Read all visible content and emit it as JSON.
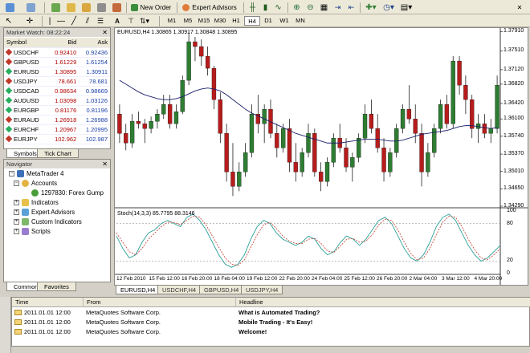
{
  "toolbar": {
    "new_order": "New Order",
    "expert_advisors": "Expert Advisors",
    "timeframes": [
      "M1",
      "M5",
      "M15",
      "M30",
      "H1",
      "H4",
      "D1",
      "W1",
      "MN"
    ],
    "active_timeframe": "H4",
    "text_tool": "A",
    "icons": [
      "new-chart-icon",
      "profiles-icon",
      "zoom-in-icon",
      "zoom-out-icon",
      "tile-icon",
      "crosshair-icon",
      "cursor-icon",
      "line-icon",
      "period-icon",
      "template-icon"
    ]
  },
  "market_watch": {
    "title": "Market Watch: 08:22:24",
    "col_symbol": "Symbol",
    "col_bid": "Bid",
    "col_ask": "Ask",
    "rows": [
      {
        "symbol": "USDCHF",
        "bid": "0.92410",
        "ask": "0.92436"
      },
      {
        "symbol": "GBPUSD",
        "bid": "1.61229",
        "ask": "1.61254"
      },
      {
        "symbol": "EURUSD",
        "bid": "1.30895",
        "ask": "1.30911"
      },
      {
        "symbol": "USDJPY",
        "bid": "78.661",
        "ask": "78.681"
      },
      {
        "symbol": "USDCAD",
        "bid": "0.98634",
        "ask": "0.98669"
      },
      {
        "symbol": "AUDUSD",
        "bid": "1.03098",
        "ask": "1.03126"
      },
      {
        "symbol": "EURGBP",
        "bid": "0.81176",
        "ask": "0.81196"
      },
      {
        "symbol": "EURAUD",
        "bid": "1.26918",
        "ask": "1.26988"
      },
      {
        "symbol": "EURCHF",
        "bid": "1.20967",
        "ask": "1.20995"
      },
      {
        "symbol": "EURJPY",
        "bid": "102.962",
        "ask": "102.987"
      }
    ],
    "tabs": [
      "Symbols",
      "Tick Chart"
    ]
  },
  "navigator": {
    "title": "Navigator",
    "root": "MetaTrader 4",
    "accounts": "Accounts",
    "account": "1297830: Forex Gump",
    "indicators": "Indicators",
    "expert_advisors": "Expert Advisors",
    "custom_indicators": "Custom Indicators",
    "scripts": "Scripts",
    "tabs": [
      "Common",
      "Favorites"
    ]
  },
  "chart": {
    "header": "EURUSD,H4  1.30865 1.30917 1.30848 1.30895",
    "stoch_header": "Stoch(14,3,3) 85.7795 88.3146",
    "price_labels": [
      "1.37910",
      "1.37510",
      "1.37120",
      "1.36820",
      "1.36420",
      "1.36100",
      "1.35740",
      "1.35370",
      "1.35010",
      "1.34650",
      "1.34290"
    ],
    "stoch_labels": [
      "100",
      "80",
      "20",
      "0"
    ],
    "time_labels": [
      "12 Feb 2010",
      "15 Feb 12:00",
      "16 Feb 20:00",
      "18 Feb 04:00",
      "19 Feb 12:00",
      "22 Feb 20:00",
      "24 Feb 04:00",
      "25 Feb 12:00",
      "26 Feb 20:00",
      "2 Mar 04:00",
      "3 Mar 12:00",
      "4 Mar 20:00"
    ],
    "tabs": [
      "EURUSD,H4",
      "USDCHF,H4",
      "GBPUSD,H4",
      "USDJPY,H4"
    ],
    "active_tab": "EURUSD,H4",
    "up_color": "#2e7d32",
    "down_color": "#b71c1c",
    "ma_color": "#1b1f6b",
    "stoch_main_color": "#2aa198",
    "stoch_signal_color": "#c0392b"
  },
  "chart_data": {
    "type": "candlestick",
    "symbol": "EURUSD",
    "timeframe": "H4",
    "ylim": [
      1.3429,
      1.3795
    ],
    "candles": [
      [
        1.362,
        1.364,
        1.356,
        1.358
      ],
      [
        1.358,
        1.36,
        1.3545,
        1.356
      ],
      [
        1.356,
        1.362,
        1.355,
        1.3605
      ],
      [
        1.3605,
        1.3625,
        1.359,
        1.36
      ],
      [
        1.36,
        1.361,
        1.356,
        1.359
      ],
      [
        1.359,
        1.3615,
        1.358,
        1.3605
      ],
      [
        1.3605,
        1.363,
        1.359,
        1.362
      ],
      [
        1.362,
        1.366,
        1.361,
        1.364
      ],
      [
        1.364,
        1.366,
        1.359,
        1.36
      ],
      [
        1.36,
        1.364,
        1.359,
        1.3625
      ],
      [
        1.3625,
        1.37,
        1.362,
        1.369
      ],
      [
        1.369,
        1.379,
        1.368,
        1.377
      ],
      [
        1.377,
        1.378,
        1.373,
        1.376
      ],
      [
        1.376,
        1.3775,
        1.372,
        1.374
      ],
      [
        1.374,
        1.376,
        1.37,
        1.3715
      ],
      [
        1.3715,
        1.372,
        1.363,
        1.365
      ],
      [
        1.365,
        1.3665,
        1.356,
        1.358
      ],
      [
        1.358,
        1.36,
        1.348,
        1.35
      ],
      [
        1.35,
        1.356,
        1.345,
        1.347
      ],
      [
        1.347,
        1.352,
        1.346,
        1.35
      ],
      [
        1.35,
        1.356,
        1.349,
        1.354
      ],
      [
        1.354,
        1.364,
        1.353,
        1.362
      ],
      [
        1.362,
        1.366,
        1.358,
        1.36
      ],
      [
        1.36,
        1.364,
        1.356,
        1.363
      ],
      [
        1.363,
        1.365,
        1.357,
        1.358
      ],
      [
        1.358,
        1.36,
        1.353,
        1.355
      ],
      [
        1.355,
        1.36,
        1.354,
        1.359
      ],
      [
        1.359,
        1.361,
        1.35,
        1.352
      ],
      [
        1.352,
        1.356,
        1.348,
        1.35
      ],
      [
        1.35,
        1.355,
        1.349,
        1.354
      ],
      [
        1.354,
        1.36,
        1.353,
        1.358
      ],
      [
        1.358,
        1.359,
        1.349,
        1.35
      ],
      [
        1.35,
        1.352,
        1.346,
        1.348
      ],
      [
        1.348,
        1.353,
        1.347,
        1.352
      ],
      [
        1.352,
        1.358,
        1.351,
        1.357
      ],
      [
        1.357,
        1.36,
        1.354,
        1.355
      ],
      [
        1.355,
        1.357,
        1.35,
        1.351
      ],
      [
        1.351,
        1.354,
        1.348,
        1.353
      ],
      [
        1.353,
        1.358,
        1.352,
        1.357
      ],
      [
        1.357,
        1.364,
        1.356,
        1.362
      ],
      [
        1.362,
        1.365,
        1.358,
        1.359
      ],
      [
        1.359,
        1.362,
        1.354,
        1.355
      ],
      [
        1.355,
        1.357,
        1.348,
        1.35
      ],
      [
        1.35,
        1.355,
        1.349,
        1.354
      ],
      [
        1.354,
        1.36,
        1.353,
        1.359
      ],
      [
        1.359,
        1.364,
        1.358,
        1.363
      ],
      [
        1.363,
        1.368,
        1.36,
        1.361
      ],
      [
        1.361,
        1.364,
        1.356,
        1.358
      ],
      [
        1.358,
        1.36,
        1.347,
        1.35
      ],
      [
        1.35,
        1.356,
        1.349,
        1.354
      ],
      [
        1.354,
        1.36,
        1.353,
        1.359
      ],
      [
        1.359,
        1.365,
        1.358,
        1.364
      ],
      [
        1.364,
        1.366,
        1.359,
        1.36
      ],
      [
        1.36,
        1.374,
        1.359,
        1.373
      ],
      [
        1.373,
        1.374,
        1.366,
        1.368
      ],
      [
        1.368,
        1.37,
        1.362,
        1.365
      ],
      [
        1.365,
        1.366,
        1.357,
        1.359
      ],
      [
        1.359,
        1.362,
        1.356,
        1.36
      ],
      [
        1.36,
        1.362,
        1.357,
        1.358
      ],
      [
        1.358,
        1.361,
        1.356,
        1.359
      ],
      [
        1.359,
        1.37,
        1.358,
        1.368
      ]
    ],
    "moving_average": [
      1.369,
      1.3682,
      1.3674,
      1.3666,
      1.366,
      1.3656,
      1.3652,
      1.365,
      1.365,
      1.3652,
      1.3656,
      1.3662,
      1.3668,
      1.3672,
      1.3674,
      1.3672,
      1.3668,
      1.366,
      1.365,
      1.364,
      1.363,
      1.3622,
      1.3616,
      1.361,
      1.3604,
      1.3598,
      1.3592,
      1.3586,
      1.358,
      1.3576,
      1.3572,
      1.3568,
      1.3564,
      1.356,
      1.356,
      1.356,
      1.3562,
      1.3564,
      1.3566,
      1.3568,
      1.3568,
      1.3568,
      1.3566,
      1.3564,
      1.3564,
      1.3566,
      1.357,
      1.3574,
      1.3578,
      1.358,
      1.3582,
      1.3584,
      1.3586,
      1.359,
      1.3594,
      1.3596,
      1.3596,
      1.3594,
      1.3592,
      1.359,
      1.3592
    ],
    "stoch_main": [
      60,
      40,
      25,
      30,
      50,
      65,
      70,
      80,
      85,
      80,
      75,
      90,
      95,
      85,
      70,
      50,
      30,
      15,
      10,
      15,
      30,
      55,
      75,
      85,
      80,
      65,
      55,
      50,
      45,
      50,
      60,
      55,
      40,
      30,
      35,
      50,
      60,
      55,
      45,
      55,
      70,
      85,
      90,
      80,
      60,
      40,
      25,
      20,
      30,
      50,
      75,
      90,
      95,
      85,
      65,
      45,
      30,
      20,
      25,
      35,
      45
    ],
    "stoch_signal": [
      65,
      50,
      35,
      30,
      40,
      55,
      65,
      75,
      82,
      82,
      78,
      85,
      92,
      90,
      78,
      60,
      42,
      25,
      15,
      13,
      22,
      42,
      62,
      78,
      82,
      72,
      60,
      52,
      48,
      48,
      55,
      56,
      48,
      36,
      34,
      44,
      55,
      56,
      50,
      52,
      62,
      78,
      87,
      85,
      70,
      50,
      32,
      22,
      25,
      40,
      62,
      82,
      92,
      90,
      75,
      55,
      38,
      25,
      22,
      30,
      40
    ],
    "stoch_levels": [
      80,
      20
    ],
    "stoch_ylim": [
      0,
      100
    ]
  },
  "terminal": {
    "col_time": "Time",
    "col_from": "From",
    "col_headline": "Headline",
    "rows": [
      {
        "time": "2011.01.01 12:00",
        "from": "MetaQuotes Software Corp.",
        "headline": "What is Automated Trading?"
      },
      {
        "time": "2011.01.01 12:00",
        "from": "MetaQuotes Software Corp.",
        "headline": "Mobile Trading - It's Easy!"
      },
      {
        "time": "2011.01.01 12:00",
        "from": "MetaQuotes Software Corp.",
        "headline": "Welcome!"
      }
    ]
  }
}
